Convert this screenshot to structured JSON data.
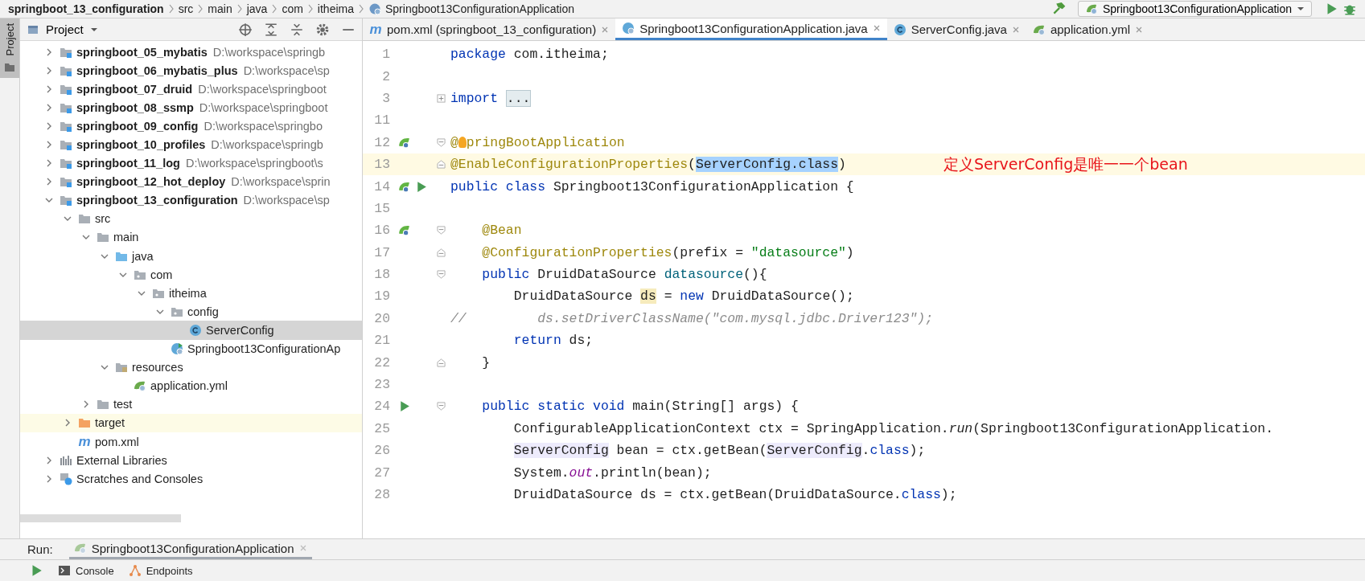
{
  "breadcrumbs": [
    {
      "label": "springboot_13_configuration",
      "bold": true
    },
    {
      "label": "src",
      "bold": false
    },
    {
      "label": "main",
      "bold": false
    },
    {
      "label": "java",
      "bold": false
    },
    {
      "label": "com",
      "bold": false
    },
    {
      "label": "itheima",
      "bold": false
    },
    {
      "label": "Springboot13ConfigurationApplication",
      "bold": false,
      "kind": "spring-class"
    }
  ],
  "run_config": {
    "label": "Springboot13ConfigurationApplication"
  },
  "side_strip": {
    "label": "Project"
  },
  "project_panel": {
    "title": "Project"
  },
  "tree": [
    {
      "label": "springboot_05_mybatis",
      "path": "D:\\workspace\\springb",
      "kind": "module",
      "expanded": false,
      "selected": false
    },
    {
      "label": "springboot_06_mybatis_plus",
      "path": "D:\\workspace\\sp",
      "kind": "module",
      "expanded": false,
      "selected": false
    },
    {
      "label": "springboot_07_druid",
      "path": "D:\\workspace\\springboot",
      "kind": "module",
      "expanded": false,
      "selected": false
    },
    {
      "label": "springboot_08_ssmp",
      "path": "D:\\workspace\\springboot",
      "kind": "module",
      "expanded": false,
      "selected": false
    },
    {
      "label": "springboot_09_config",
      "path": "D:\\workspace\\springbo",
      "kind": "module",
      "expanded": false,
      "selected": false
    },
    {
      "label": "springboot_10_profiles",
      "path": "D:\\workspace\\springb",
      "kind": "module",
      "expanded": false,
      "selected": false
    },
    {
      "label": "springboot_11_log",
      "path": "D:\\workspace\\springboot\\s",
      "kind": "module",
      "expanded": false,
      "selected": false
    },
    {
      "label": "springboot_12_hot_deploy",
      "path": "D:\\workspace\\sprin",
      "kind": "module",
      "expanded": false,
      "selected": false
    },
    {
      "label": "springboot_13_configuration",
      "path": "D:\\workspace\\sp",
      "kind": "module",
      "expanded": true,
      "selected": false,
      "children": [
        {
          "label": "src",
          "kind": "folder",
          "expanded": true,
          "selected": false,
          "children": [
            {
              "label": "main",
              "kind": "folder",
              "expanded": true,
              "selected": false,
              "children": [
                {
                  "label": "java",
                  "kind": "source-folder",
                  "expanded": true,
                  "selected": false,
                  "children": [
                    {
                      "label": "com",
                      "kind": "package",
                      "expanded": true,
                      "selected": false,
                      "children": [
                        {
                          "label": "itheima",
                          "kind": "package",
                          "expanded": true,
                          "selected": false,
                          "children": [
                            {
                              "label": "config",
                              "kind": "package",
                              "expanded": true,
                              "selected": false,
                              "children": [
                                {
                                  "label": "ServerConfig",
                                  "kind": "class",
                                  "selected": true
                                }
                              ]
                            },
                            {
                              "label": "Springboot13ConfigurationAp",
                              "kind": "spring-class",
                              "selected": false
                            }
                          ]
                        }
                      ]
                    }
                  ]
                },
                {
                  "label": "resources",
                  "kind": "resources",
                  "expanded": true,
                  "selected": false,
                  "children": [
                    {
                      "label": "application.yml",
                      "kind": "yml",
                      "selected": false
                    }
                  ]
                }
              ]
            },
            {
              "label": "test",
              "kind": "folder",
              "expanded": false,
              "selected": false
            }
          ]
        },
        {
          "label": "target",
          "kind": "excluded-folder",
          "expanded": false,
          "selected": false
        },
        {
          "label": "pom.xml",
          "kind": "maven",
          "glyph": "m",
          "selected": false
        }
      ]
    },
    {
      "label": "External Libraries",
      "kind": "libraries",
      "expanded": false,
      "selected": false
    },
    {
      "label": "Scratches and Consoles",
      "kind": "scratches",
      "expanded": false,
      "selected": false
    }
  ],
  "tabs": [
    {
      "label": "pom.xml (springboot_13_configuration)",
      "kind": "maven",
      "glyph": "m",
      "selected": false
    },
    {
      "label": "Springboot13ConfigurationApplication.java",
      "kind": "spring-class",
      "selected": true
    },
    {
      "label": "ServerConfig.java",
      "kind": "class",
      "selected": false
    },
    {
      "label": "application.yml",
      "kind": "yml",
      "selected": false
    }
  ],
  "lines": [
    {
      "number": "1",
      "segments": [
        {
          "kind": "kw",
          "text": "package"
        },
        {
          "kind": "plain",
          "text": " com.itheima;"
        }
      ]
    },
    {
      "number": "2"
    },
    {
      "number": "3",
      "fold": {
        "kind": "plus"
      },
      "segments": [
        {
          "kind": "kw",
          "text": "import "
        },
        {
          "kind": "folded",
          "text": "..."
        }
      ]
    },
    {
      "number": "11"
    },
    {
      "number": "12",
      "fold": {
        "kind": "open"
      },
      "markers": [
        {
          "kind": "bean"
        }
      ],
      "segments": [
        {
          "kind": "ann",
          "text": "@"
        },
        {
          "kind": "bulb"
        },
        {
          "kind": "ann",
          "text": "pringBootApplication"
        }
      ]
    },
    {
      "number": "13",
      "fold": {
        "kind": "end"
      },
      "current": true,
      "note": "定义ServerConfig是唯一一个bean",
      "segments": [
        {
          "kind": "ann",
          "text": "@EnableConfigurationProperties"
        },
        {
          "kind": "plain",
          "text": "("
        },
        {
          "kind": "sel",
          "text": "ServerConfig.class"
        },
        {
          "kind": "plain",
          "text": ")"
        }
      ]
    },
    {
      "number": "14",
      "markers": [
        {
          "kind": "bean"
        },
        {
          "kind": "run"
        }
      ],
      "segments": [
        {
          "kind": "kw",
          "text": "public class"
        },
        {
          "kind": "plain",
          "text": " Springboot13ConfigurationApplication {"
        }
      ]
    },
    {
      "number": "15"
    },
    {
      "number": "16",
      "fold": {
        "kind": "open"
      },
      "markers": [
        {
          "kind": "bean"
        }
      ],
      "segments": [
        {
          "kind": "ann",
          "text": "    @Bean"
        }
      ]
    },
    {
      "number": "17",
      "fold": {
        "kind": "end"
      },
      "segments": [
        {
          "kind": "ann",
          "text": "    @ConfigurationProperties"
        },
        {
          "kind": "plain",
          "text": "(prefix = "
        },
        {
          "kind": "str",
          "text": "\"datasource\""
        },
        {
          "kind": "plain",
          "text": ")"
        }
      ]
    },
    {
      "number": "18",
      "fold": {
        "kind": "open"
      },
      "segments": [
        {
          "kind": "kw",
          "text": "    public"
        },
        {
          "kind": "plain",
          "text": " DruidDataSource "
        },
        {
          "kind": "method",
          "text": "datasource"
        },
        {
          "kind": "plain",
          "text": "(){"
        }
      ]
    },
    {
      "number": "19",
      "segments": [
        {
          "kind": "plain",
          "text": "        DruidDataSource "
        },
        {
          "kind": "usage",
          "text": "ds"
        },
        {
          "kind": "plain",
          "text": " = "
        },
        {
          "kind": "kw",
          "text": "new"
        },
        {
          "kind": "plain",
          "text": " DruidDataSource();"
        }
      ]
    },
    {
      "number": "20",
      "segments": [
        {
          "kind": "cmt",
          "text": "//         ds.setDriverClassName(\"com.mysql.jdbc.Driver123\");"
        }
      ]
    },
    {
      "number": "21",
      "segments": [
        {
          "kind": "kw",
          "text": "        return"
        },
        {
          "kind": "plain",
          "text": " ds;"
        }
      ]
    },
    {
      "number": "22",
      "fold": {
        "kind": "end"
      },
      "segments": [
        {
          "kind": "plain",
          "text": "    }"
        }
      ]
    },
    {
      "number": "23"
    },
    {
      "number": "24",
      "fold": {
        "kind": "open"
      },
      "markers": [
        {
          "kind": "run"
        }
      ],
      "segments": [
        {
          "kind": "kw",
          "text": "    public static void"
        },
        {
          "kind": "plain",
          "text": " main(String[] args) {"
        }
      ]
    },
    {
      "number": "25",
      "segments": [
        {
          "kind": "plain",
          "text": "        ConfigurableApplicationContext ctx = SpringApplication."
        },
        {
          "kind": "italic",
          "text": "run"
        },
        {
          "kind": "plain",
          "text": "(Springboot13ConfigurationApplication."
        }
      ]
    },
    {
      "number": "26",
      "segments": [
        {
          "kind": "ref",
          "text": "        ServerConfig"
        },
        {
          "kind": "plain",
          "text": " bean = ctx.getBean("
        },
        {
          "kind": "ref",
          "text": "ServerConfig"
        },
        {
          "kind": "plain",
          "text": "."
        },
        {
          "kind": "kw",
          "text": "class"
        },
        {
          "kind": "plain",
          "text": ");"
        }
      ]
    },
    {
      "number": "27",
      "segments": [
        {
          "kind": "plain",
          "text": "        System."
        },
        {
          "kind": "static",
          "text": "out"
        },
        {
          "kind": "plain",
          "text": ".println(bean);"
        }
      ]
    },
    {
      "number": "28",
      "segments": [
        {
          "kind": "plain",
          "text": "        DruidDataSource ds = ctx.getBean(DruidDataSource."
        },
        {
          "kind": "kw",
          "text": "class"
        },
        {
          "kind": "plain",
          "text": ");"
        }
      ]
    }
  ],
  "run_bar": {
    "label": "Run:",
    "tab": {
      "label": "Springboot13ConfigurationApplication",
      "selected": true
    }
  },
  "run_tabs": [
    {
      "label": "Console",
      "kind": "console"
    },
    {
      "label": "Endpoints",
      "kind": "endpoints"
    }
  ]
}
